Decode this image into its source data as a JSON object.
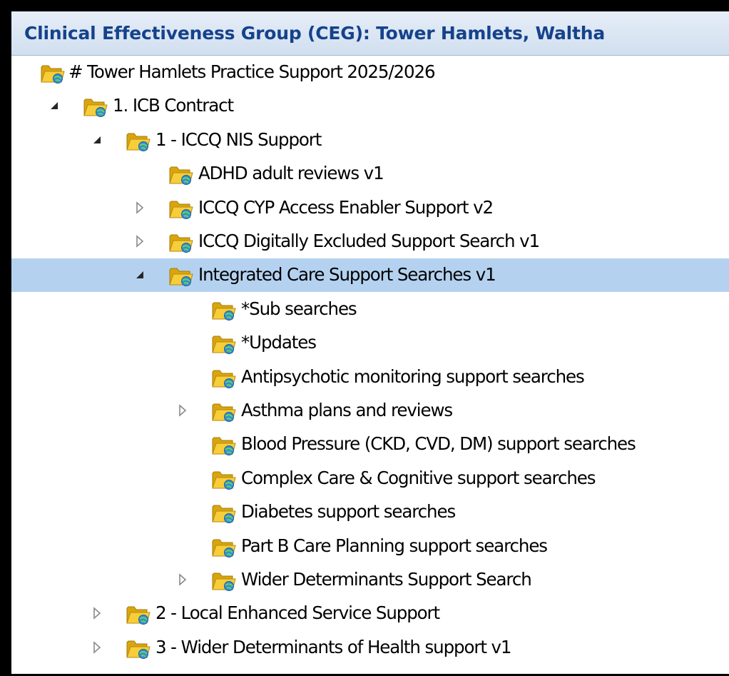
{
  "header": {
    "title": "Clinical Effectiveness Group (CEG): Tower Hamlets, Waltha"
  },
  "tree": {
    "nodes": [
      {
        "label": "# Tower Hamlets Practice Support 2025/2026",
        "level": 0,
        "toggle": "none",
        "selected": false
      },
      {
        "label": "1. ICB Contract",
        "level": 1,
        "toggle": "expanded",
        "selected": false
      },
      {
        "label": "1 - ICCQ NIS Support",
        "level": 2,
        "toggle": "expanded",
        "selected": false
      },
      {
        "label": "ADHD adult reviews v1",
        "level": 3,
        "toggle": "none",
        "selected": false
      },
      {
        "label": "ICCQ CYP Access Enabler Support v2",
        "level": 3,
        "toggle": "collapsed",
        "selected": false
      },
      {
        "label": "ICCQ Digitally Excluded Support Search v1",
        "level": 3,
        "toggle": "collapsed",
        "selected": false
      },
      {
        "label": "Integrated Care Support Searches v1",
        "level": 3,
        "toggle": "expanded",
        "selected": true
      },
      {
        "label": "*Sub searches",
        "level": 4,
        "toggle": "none",
        "selected": false
      },
      {
        "label": "*Updates",
        "level": 4,
        "toggle": "none",
        "selected": false
      },
      {
        "label": "Antipsychotic monitoring support searches",
        "level": 4,
        "toggle": "none",
        "selected": false
      },
      {
        "label": "Asthma plans and reviews",
        "level": 4,
        "toggle": "collapsed",
        "selected": false
      },
      {
        "label": "Blood Pressure (CKD, CVD, DM) support searches",
        "level": 4,
        "toggle": "none",
        "selected": false
      },
      {
        "label": "Complex Care & Cognitive support searches",
        "level": 4,
        "toggle": "none",
        "selected": false
      },
      {
        "label": "Diabetes support searches",
        "level": 4,
        "toggle": "none",
        "selected": false
      },
      {
        "label": "Part B Care Planning support searches",
        "level": 4,
        "toggle": "none",
        "selected": false
      },
      {
        "label": "Wider Determinants Support Search",
        "level": 4,
        "toggle": "collapsed",
        "selected": false
      },
      {
        "label": "2 - Local Enhanced Service Support",
        "level": 2,
        "toggle": "collapsed",
        "selected": false
      },
      {
        "label": "3 - Wider Determinants of Health support v1",
        "level": 2,
        "toggle": "collapsed",
        "selected": false
      }
    ]
  },
  "colors": {
    "header_text": "#15428b",
    "selection": "#b4d2f0",
    "folder": "#f5c518",
    "badge": "#2f8fd8"
  },
  "icons": {
    "folder": "folder-icon",
    "expanded": "expanded-arrow-icon",
    "collapsed": "collapsed-arrow-icon"
  }
}
